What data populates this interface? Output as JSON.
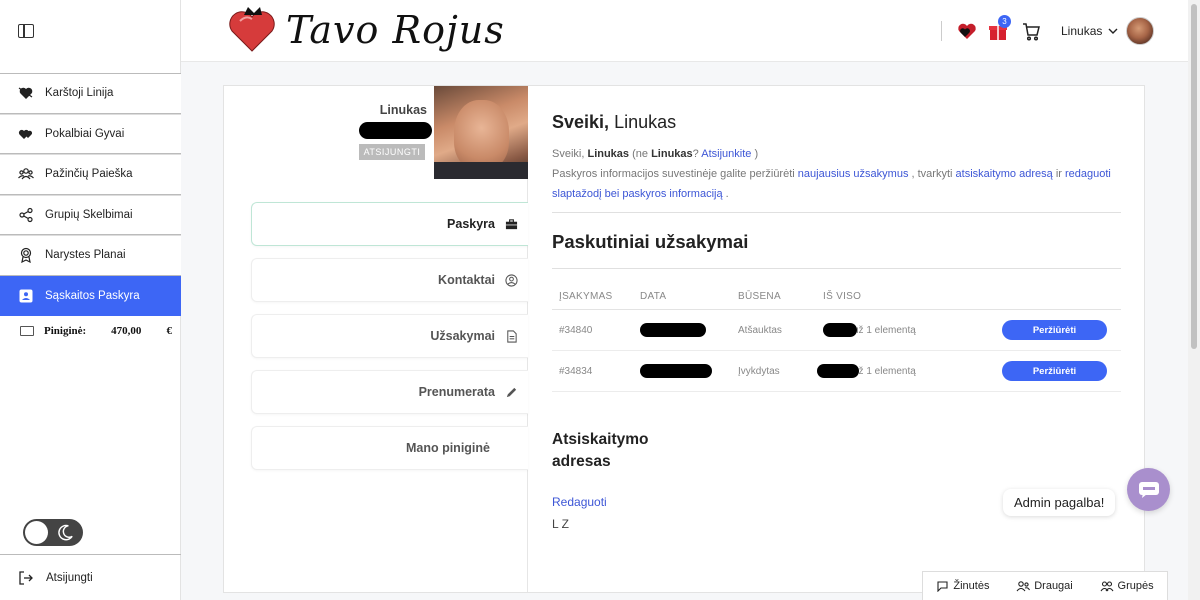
{
  "sidebar": {
    "items": [
      {
        "label": "Karštoji Linija",
        "icon": "heart-arrow-icon"
      },
      {
        "label": "Pokalbiai Gyvai",
        "icon": "chat-hearts-icon"
      },
      {
        "label": "Pažinčių Paieška",
        "icon": "people-search-icon"
      },
      {
        "label": "Grupių Skelbimai",
        "icon": "share-icon"
      },
      {
        "label": "Narystes Planai",
        "icon": "award-icon"
      },
      {
        "label": "Sąskaitos Paskyra",
        "icon": "account-card-icon",
        "active": true
      }
    ],
    "wallet": {
      "label": "Piniginė:",
      "amount": "470,00",
      "currency": "€"
    },
    "logout_label": "Atsijungti"
  },
  "header": {
    "brand": "Tavo Rojus",
    "cart_badge": "3",
    "username": "Linukas"
  },
  "profile": {
    "name": "Linukas",
    "status": "ATSIJUNGTI"
  },
  "tabs": [
    {
      "label": "Paskyra",
      "icon": "briefcase-icon",
      "active": true
    },
    {
      "label": "Kontaktai",
      "icon": "user-circle-icon"
    },
    {
      "label": "Užsakymai",
      "icon": "document-icon"
    },
    {
      "label": "Prenumerata",
      "icon": "pencil-icon"
    },
    {
      "label": "Mano piniginė",
      "icon": ""
    }
  ],
  "account": {
    "greeting_bold": "Sveiki,",
    "greeting_name": "Linukas",
    "intro": {
      "p1": "Sveiki,",
      "name1": "Linukas",
      "p2": "(ne",
      "name2": "Linukas",
      "p3": "?",
      "logout_link": "Atsijunkite",
      "p4": ")",
      "p5": "Paskyros informacijos suvestinėje galite peržiūrėti",
      "link_orders": "naujausius užsakymus",
      "p6": ", tvarkyti",
      "link_address": "atsiskaitymo adresą",
      "p7": "ir",
      "link_edit": "redaguoti slaptažodį bei paskyros informaciją",
      "p8": "."
    },
    "orders_title": "Paskutiniai užsakymai",
    "columns": [
      "ĮSAKYMAS",
      "DATA",
      "BŪSENA",
      "IŠ VISO"
    ],
    "orders": [
      {
        "id": "#34840",
        "status": "Atšauktas",
        "total": "už 1 elementą",
        "action": "Peržiūrėti"
      },
      {
        "id": "#34834",
        "status": "Įvykdytas",
        "total": "už 1 elementą",
        "action": "Peržiūrėti"
      }
    ],
    "billing_title": "Atsiskaitymo adresas",
    "billing_edit": "Redaguoti",
    "billing_address": "L Z"
  },
  "help": {
    "label": "Admin pagalba!"
  },
  "bottom_bar": {
    "messages": "Žinutės",
    "friends": "Draugai",
    "groups": "Grupės"
  }
}
